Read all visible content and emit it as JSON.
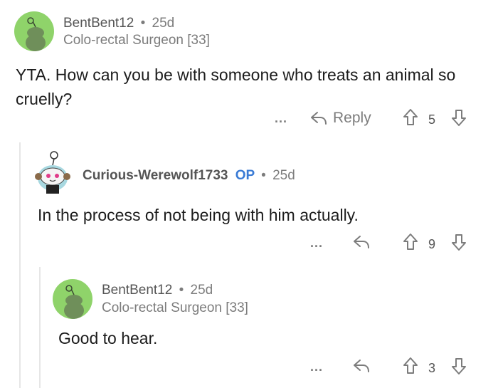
{
  "comments": [
    {
      "username": "BentBent12",
      "separator": "•",
      "age": "25d",
      "flair": "Colo-rectal Surgeon [33]",
      "body": "YTA.  How can you be with someone who treats an animal so cruelly?",
      "more": "...",
      "reply_label": "Reply",
      "votes": "5"
    },
    {
      "username": "Curious-Werewolf1733",
      "op_badge": "OP",
      "separator": "•",
      "age": "25d",
      "body": "In the process of not being with him actually.",
      "more": "...",
      "votes": "9"
    },
    {
      "username": "BentBent12",
      "separator": "•",
      "age": "25d",
      "flair": "Colo-rectal Surgeon [33]",
      "body": "Good to hear.",
      "more": "...",
      "votes": "3"
    }
  ],
  "colors": {
    "avatar_green": "#8fd36a",
    "op_blue": "#3a7bd5",
    "text": "#1c1c1c",
    "muted": "#7c7c7c"
  }
}
